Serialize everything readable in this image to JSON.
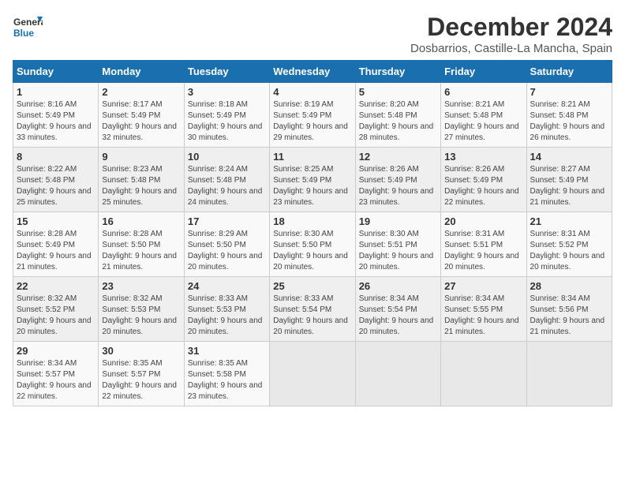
{
  "logo": {
    "line1": "General",
    "line2": "Blue"
  },
  "title": "December 2024",
  "subtitle": "Dosbarrios, Castille-La Mancha, Spain",
  "days_of_week": [
    "Sunday",
    "Monday",
    "Tuesday",
    "Wednesday",
    "Thursday",
    "Friday",
    "Saturday"
  ],
  "weeks": [
    [
      {
        "day": "1",
        "sunrise": "8:16 AM",
        "sunset": "5:49 PM",
        "daylight": "9 hours and 33 minutes"
      },
      {
        "day": "2",
        "sunrise": "8:17 AM",
        "sunset": "5:49 PM",
        "daylight": "9 hours and 32 minutes"
      },
      {
        "day": "3",
        "sunrise": "8:18 AM",
        "sunset": "5:49 PM",
        "daylight": "9 hours and 30 minutes"
      },
      {
        "day": "4",
        "sunrise": "8:19 AM",
        "sunset": "5:49 PM",
        "daylight": "9 hours and 29 minutes"
      },
      {
        "day": "5",
        "sunrise": "8:20 AM",
        "sunset": "5:48 PM",
        "daylight": "9 hours and 28 minutes"
      },
      {
        "day": "6",
        "sunrise": "8:21 AM",
        "sunset": "5:48 PM",
        "daylight": "9 hours and 27 minutes"
      },
      {
        "day": "7",
        "sunrise": "8:21 AM",
        "sunset": "5:48 PM",
        "daylight": "9 hours and 26 minutes"
      }
    ],
    [
      {
        "day": "8",
        "sunrise": "8:22 AM",
        "sunset": "5:48 PM",
        "daylight": "9 hours and 25 minutes"
      },
      {
        "day": "9",
        "sunrise": "8:23 AM",
        "sunset": "5:48 PM",
        "daylight": "9 hours and 25 minutes"
      },
      {
        "day": "10",
        "sunrise": "8:24 AM",
        "sunset": "5:48 PM",
        "daylight": "9 hours and 24 minutes"
      },
      {
        "day": "11",
        "sunrise": "8:25 AM",
        "sunset": "5:49 PM",
        "daylight": "9 hours and 23 minutes"
      },
      {
        "day": "12",
        "sunrise": "8:26 AM",
        "sunset": "5:49 PM",
        "daylight": "9 hours and 23 minutes"
      },
      {
        "day": "13",
        "sunrise": "8:26 AM",
        "sunset": "5:49 PM",
        "daylight": "9 hours and 22 minutes"
      },
      {
        "day": "14",
        "sunrise": "8:27 AM",
        "sunset": "5:49 PM",
        "daylight": "9 hours and 21 minutes"
      }
    ],
    [
      {
        "day": "15",
        "sunrise": "8:28 AM",
        "sunset": "5:49 PM",
        "daylight": "9 hours and 21 minutes"
      },
      {
        "day": "16",
        "sunrise": "8:28 AM",
        "sunset": "5:50 PM",
        "daylight": "9 hours and 21 minutes"
      },
      {
        "day": "17",
        "sunrise": "8:29 AM",
        "sunset": "5:50 PM",
        "daylight": "9 hours and 20 minutes"
      },
      {
        "day": "18",
        "sunrise": "8:30 AM",
        "sunset": "5:50 PM",
        "daylight": "9 hours and 20 minutes"
      },
      {
        "day": "19",
        "sunrise": "8:30 AM",
        "sunset": "5:51 PM",
        "daylight": "9 hours and 20 minutes"
      },
      {
        "day": "20",
        "sunrise": "8:31 AM",
        "sunset": "5:51 PM",
        "daylight": "9 hours and 20 minutes"
      },
      {
        "day": "21",
        "sunrise": "8:31 AM",
        "sunset": "5:52 PM",
        "daylight": "9 hours and 20 minutes"
      }
    ],
    [
      {
        "day": "22",
        "sunrise": "8:32 AM",
        "sunset": "5:52 PM",
        "daylight": "9 hours and 20 minutes"
      },
      {
        "day": "23",
        "sunrise": "8:32 AM",
        "sunset": "5:53 PM",
        "daylight": "9 hours and 20 minutes"
      },
      {
        "day": "24",
        "sunrise": "8:33 AM",
        "sunset": "5:53 PM",
        "daylight": "9 hours and 20 minutes"
      },
      {
        "day": "25",
        "sunrise": "8:33 AM",
        "sunset": "5:54 PM",
        "daylight": "9 hours and 20 minutes"
      },
      {
        "day": "26",
        "sunrise": "8:34 AM",
        "sunset": "5:54 PM",
        "daylight": "9 hours and 20 minutes"
      },
      {
        "day": "27",
        "sunrise": "8:34 AM",
        "sunset": "5:55 PM",
        "daylight": "9 hours and 21 minutes"
      },
      {
        "day": "28",
        "sunrise": "8:34 AM",
        "sunset": "5:56 PM",
        "daylight": "9 hours and 21 minutes"
      }
    ],
    [
      {
        "day": "29",
        "sunrise": "8:34 AM",
        "sunset": "5:57 PM",
        "daylight": "9 hours and 22 minutes"
      },
      {
        "day": "30",
        "sunrise": "8:35 AM",
        "sunset": "5:57 PM",
        "daylight": "9 hours and 22 minutes"
      },
      {
        "day": "31",
        "sunrise": "8:35 AM",
        "sunset": "5:58 PM",
        "daylight": "9 hours and 23 minutes"
      },
      null,
      null,
      null,
      null
    ]
  ]
}
